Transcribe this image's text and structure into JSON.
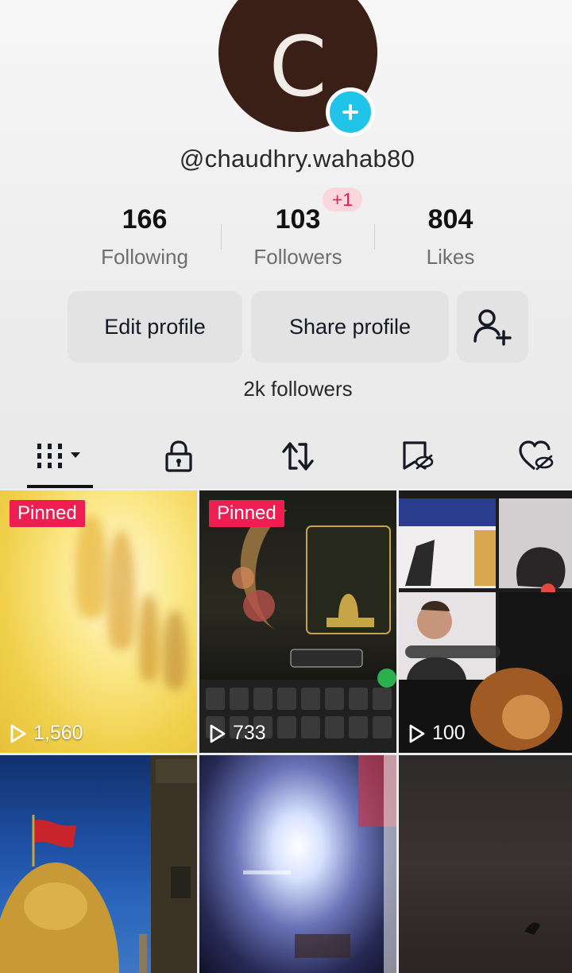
{
  "profile": {
    "avatar_letter": "C",
    "username": "@chaudhry.wahab80",
    "followers_badge": "+1",
    "stats": [
      {
        "value": "166",
        "label": "Following"
      },
      {
        "value": "103",
        "label": "Followers"
      },
      {
        "value": "804",
        "label": "Likes"
      }
    ],
    "buttons": {
      "edit": "Edit profile",
      "share": "Share profile"
    },
    "followers_note": "2k followers"
  },
  "tabs": [
    "videos-grid",
    "private-lock",
    "repost",
    "saved-bookmark",
    "liked-heart"
  ],
  "videos": [
    {
      "pinned_label": "Pinned",
      "views": "1,560"
    },
    {
      "pinned_label": "Pinned",
      "views": "733"
    },
    {
      "pinned_label": "",
      "views": "100"
    }
  ],
  "colors": {
    "accent": "#ee1d52",
    "avatar_bg": "#3a1f17",
    "plus_badge": "#20c4e8"
  }
}
